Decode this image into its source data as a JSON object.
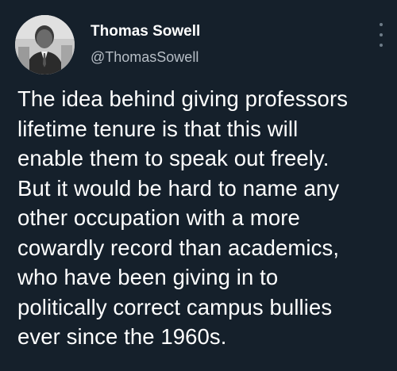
{
  "author": {
    "display_name": "Thomas Sowell",
    "handle": "@ThomasSowell",
    "avatar_icon": "profile-photo"
  },
  "menu": {
    "icon": "more-vertical-icon"
  },
  "tweet": {
    "lines": [
      "The idea behind giving professors",
      "lifetime tenure is that this will",
      "enable them to speak out freely.",
      "But it would be hard to name any",
      "other occupation with a more",
      "cowardly record than academics,",
      "who have been giving in to",
      "politically correct campus bullies",
      "ever since the 1960s."
    ]
  },
  "colors": {
    "background": "#15202b",
    "text_primary": "#ffffff",
    "text_secondary": "#b7bec6"
  }
}
